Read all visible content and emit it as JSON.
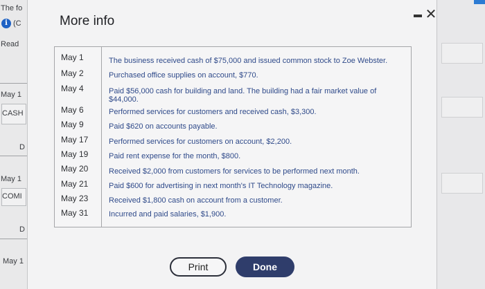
{
  "background": {
    "left_fragments": [
      "The fo",
      "(C",
      "Read",
      "May 1",
      "CASH",
      "D",
      "May 1",
      "COMI",
      "D",
      "May 1"
    ],
    "info_icon_glyph": "i"
  },
  "modal": {
    "title": "More info",
    "minimize_glyph": "",
    "close_glyph": "✕",
    "rows": [
      {
        "date": "May 1",
        "desc": "The business received cash of $75,000 and issued common stock to Zoe Webster."
      },
      {
        "date": "May 2",
        "desc": "Purchased office supplies on account, $770."
      },
      {
        "date": "May 4",
        "desc": "Paid $56,000 cash for building and land. The building had a fair market value of",
        "desc2": "$44,000."
      },
      {
        "date": "May 6",
        "desc": "Performed services for customers and received cash, $3,300."
      },
      {
        "date": "May 9",
        "desc": "Paid $620 on accounts payable."
      },
      {
        "date": "May 17",
        "desc": "Performed services for customers on account, $2,200."
      },
      {
        "date": "May 19",
        "desc": "Paid rent expense for the month, $800."
      },
      {
        "date": "May 20",
        "desc": "Received $2,000 from customers for services to be performed next month."
      },
      {
        "date": "May 21",
        "desc": "Paid $600 for advertising in next month's IT Technology magazine."
      },
      {
        "date": "May 23",
        "desc": "Received $1,800 cash on account from a customer."
      },
      {
        "date": "May 31",
        "desc": "Incurred and paid salaries, $1,900."
      }
    ],
    "print_label": "Print",
    "done_label": "Done"
  },
  "colors": {
    "accent": "#2f3d6b",
    "info_icon": "#1f62c4"
  }
}
